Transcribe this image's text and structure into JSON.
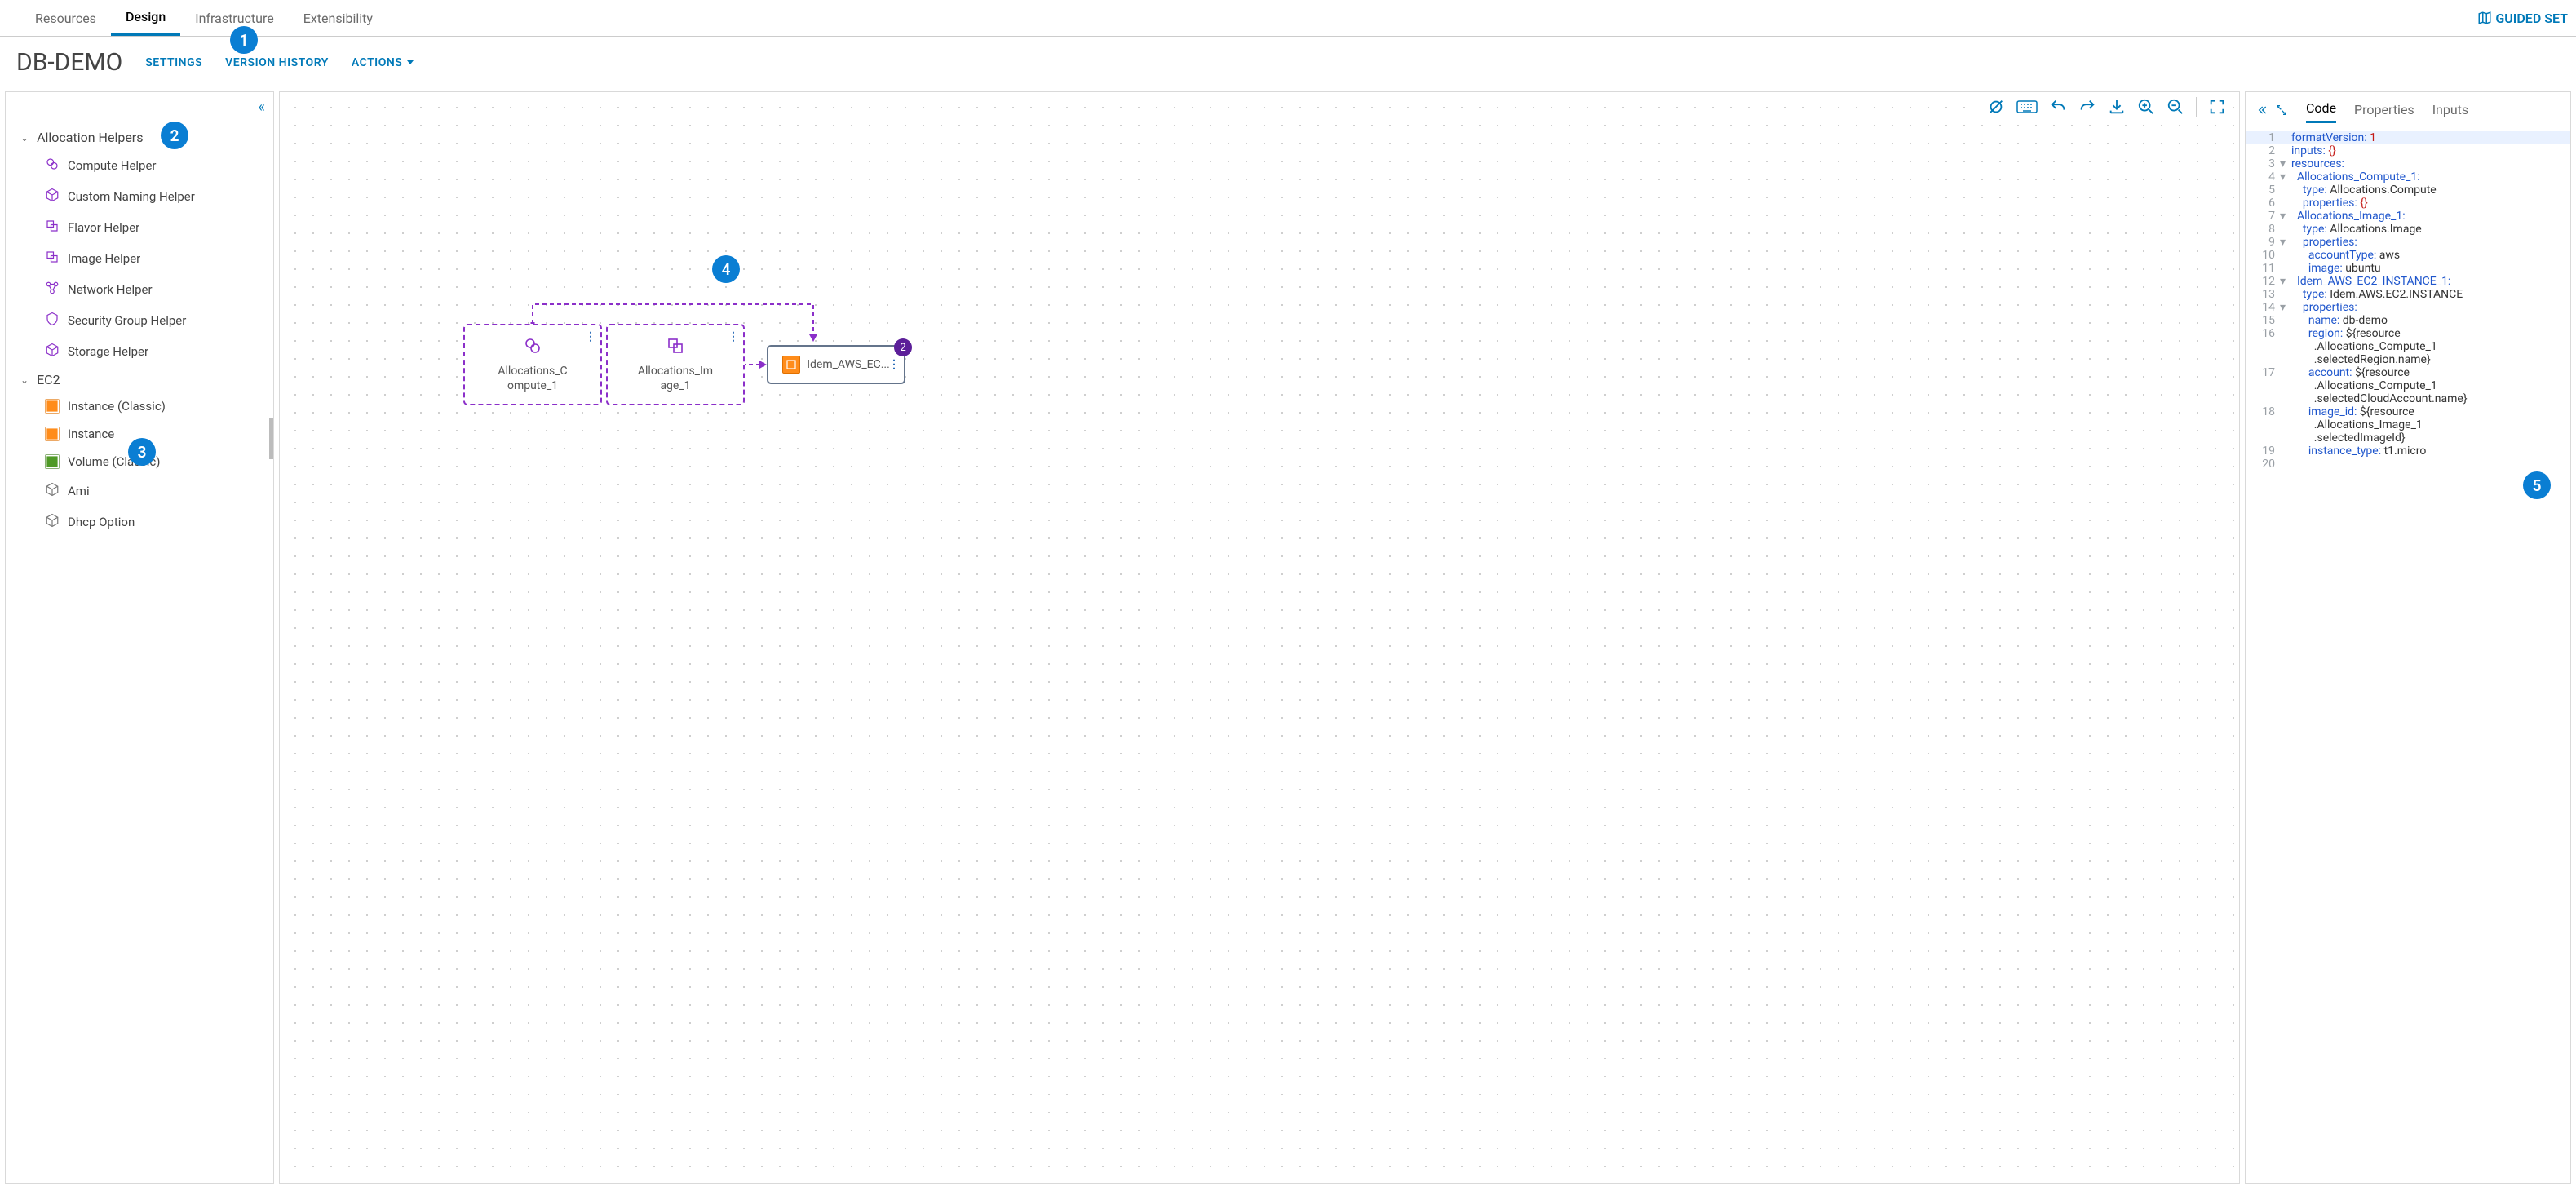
{
  "nav": {
    "tabs": [
      "Resources",
      "Design",
      "Infrastructure",
      "Extensibility"
    ],
    "active": "Design",
    "guided": "GUIDED SET"
  },
  "header": {
    "title": "DB-DEMO",
    "settings": "SETTINGS",
    "version_history": "VERSION HISTORY",
    "actions": "ACTIONS"
  },
  "sidebar": {
    "groups": [
      {
        "label": "Allocation Helpers",
        "items": [
          {
            "label": "Compute Helper",
            "icon": "compute"
          },
          {
            "label": "Custom Naming Helper",
            "icon": "cube"
          },
          {
            "label": "Flavor Helper",
            "icon": "flavor"
          },
          {
            "label": "Image Helper",
            "icon": "image"
          },
          {
            "label": "Network Helper",
            "icon": "network"
          },
          {
            "label": "Security Group Helper",
            "icon": "security"
          },
          {
            "label": "Storage Helper",
            "icon": "cube"
          }
        ]
      },
      {
        "label": "EC2",
        "items": [
          {
            "label": "Instance (Classic)",
            "icon": "aws-orange"
          },
          {
            "label": "Instance",
            "icon": "aws-orange"
          },
          {
            "label": "Volume (Classic)",
            "icon": "aws-green"
          },
          {
            "label": "Ami",
            "icon": "cube-gray"
          },
          {
            "label": "Dhcp Option",
            "icon": "cube-gray"
          }
        ]
      }
    ]
  },
  "canvas": {
    "nodes": {
      "compute": {
        "line1": "Allocations_C",
        "line2": "ompute_1"
      },
      "image": {
        "line1": "Allocations_Im",
        "line2": "age_1"
      },
      "ec2": {
        "label": "Idem_AWS_EC...",
        "badge": "2"
      }
    }
  },
  "rightPanel": {
    "tabs": [
      "Code",
      "Properties",
      "Inputs"
    ],
    "active": "Code",
    "code": [
      {
        "n": 1,
        "fold": "",
        "t": [
          [
            "key",
            "formatVersion:"
          ],
          [
            "txt",
            " "
          ],
          [
            "num",
            "1"
          ]
        ],
        "cur": true
      },
      {
        "n": 2,
        "fold": "",
        "t": [
          [
            "key",
            "inputs:"
          ],
          [
            "txt",
            " "
          ],
          [
            "br",
            "{}"
          ]
        ]
      },
      {
        "n": 3,
        "fold": "▾",
        "t": [
          [
            "key",
            "resources:"
          ]
        ]
      },
      {
        "n": 4,
        "fold": "▾",
        "t": [
          [
            "txt",
            "  "
          ],
          [
            "idnt",
            "Allocations_Compute_1:"
          ]
        ]
      },
      {
        "n": 5,
        "fold": "",
        "t": [
          [
            "txt",
            "    "
          ],
          [
            "key",
            "type:"
          ],
          [
            "txt",
            " Allocations.Compute"
          ]
        ]
      },
      {
        "n": 6,
        "fold": "",
        "t": [
          [
            "txt",
            "    "
          ],
          [
            "key",
            "properties:"
          ],
          [
            "txt",
            " "
          ],
          [
            "br",
            "{}"
          ]
        ]
      },
      {
        "n": 7,
        "fold": "▾",
        "t": [
          [
            "txt",
            "  "
          ],
          [
            "idnt",
            "Allocations_Image_1:"
          ]
        ]
      },
      {
        "n": 8,
        "fold": "",
        "t": [
          [
            "txt",
            "    "
          ],
          [
            "key",
            "type:"
          ],
          [
            "txt",
            " Allocations.Image"
          ]
        ]
      },
      {
        "n": 9,
        "fold": "▾",
        "t": [
          [
            "txt",
            "    "
          ],
          [
            "key",
            "properties:"
          ]
        ]
      },
      {
        "n": 10,
        "fold": "",
        "t": [
          [
            "txt",
            "      "
          ],
          [
            "key",
            "accountType:"
          ],
          [
            "txt",
            " aws"
          ]
        ]
      },
      {
        "n": 11,
        "fold": "",
        "t": [
          [
            "txt",
            "      "
          ],
          [
            "key",
            "image:"
          ],
          [
            "txt",
            " ubuntu"
          ]
        ]
      },
      {
        "n": 12,
        "fold": "▾",
        "t": [
          [
            "txt",
            "  "
          ],
          [
            "idnt",
            "Idem_AWS_EC2_INSTANCE_1:"
          ]
        ]
      },
      {
        "n": 13,
        "fold": "",
        "t": [
          [
            "txt",
            "    "
          ],
          [
            "key",
            "type:"
          ],
          [
            "txt",
            " Idem.AWS.EC2.INSTANCE"
          ]
        ]
      },
      {
        "n": 14,
        "fold": "▾",
        "t": [
          [
            "txt",
            "    "
          ],
          [
            "key",
            "properties:"
          ]
        ]
      },
      {
        "n": 15,
        "fold": "",
        "t": [
          [
            "txt",
            "      "
          ],
          [
            "key",
            "name:"
          ],
          [
            "txt",
            " db-demo"
          ]
        ]
      },
      {
        "n": 16,
        "fold": "",
        "t": [
          [
            "txt",
            "      "
          ],
          [
            "key",
            "region:"
          ],
          [
            "txt",
            " ${resource"
          ]
        ]
      },
      {
        "n": 0,
        "fold": "",
        "t": [
          [
            "txt",
            "        .Allocations_Compute_1"
          ]
        ]
      },
      {
        "n": 0,
        "fold": "",
        "t": [
          [
            "txt",
            "        .selectedRegion.name}"
          ]
        ]
      },
      {
        "n": 17,
        "fold": "",
        "t": [
          [
            "txt",
            "      "
          ],
          [
            "key",
            "account:"
          ],
          [
            "txt",
            " ${resource"
          ]
        ]
      },
      {
        "n": 0,
        "fold": "",
        "t": [
          [
            "txt",
            "        .Allocations_Compute_1"
          ]
        ]
      },
      {
        "n": 0,
        "fold": "",
        "t": [
          [
            "txt",
            "        .selectedCloudAccount.name}"
          ]
        ]
      },
      {
        "n": 18,
        "fold": "",
        "t": [
          [
            "txt",
            "      "
          ],
          [
            "key",
            "image_id:"
          ],
          [
            "txt",
            " ${resource"
          ]
        ]
      },
      {
        "n": 0,
        "fold": "",
        "t": [
          [
            "txt",
            "        .Allocations_Image_1"
          ]
        ]
      },
      {
        "n": 0,
        "fold": "",
        "t": [
          [
            "txt",
            "        .selectedImageId}"
          ]
        ]
      },
      {
        "n": 19,
        "fold": "",
        "t": [
          [
            "txt",
            "      "
          ],
          [
            "key",
            "instance_type:"
          ],
          [
            "txt",
            " t1.micro"
          ]
        ]
      },
      {
        "n": 20,
        "fold": "",
        "t": [
          [
            "txt",
            ""
          ]
        ]
      }
    ]
  },
  "callouts": [
    "1",
    "2",
    "3",
    "4",
    "5"
  ]
}
